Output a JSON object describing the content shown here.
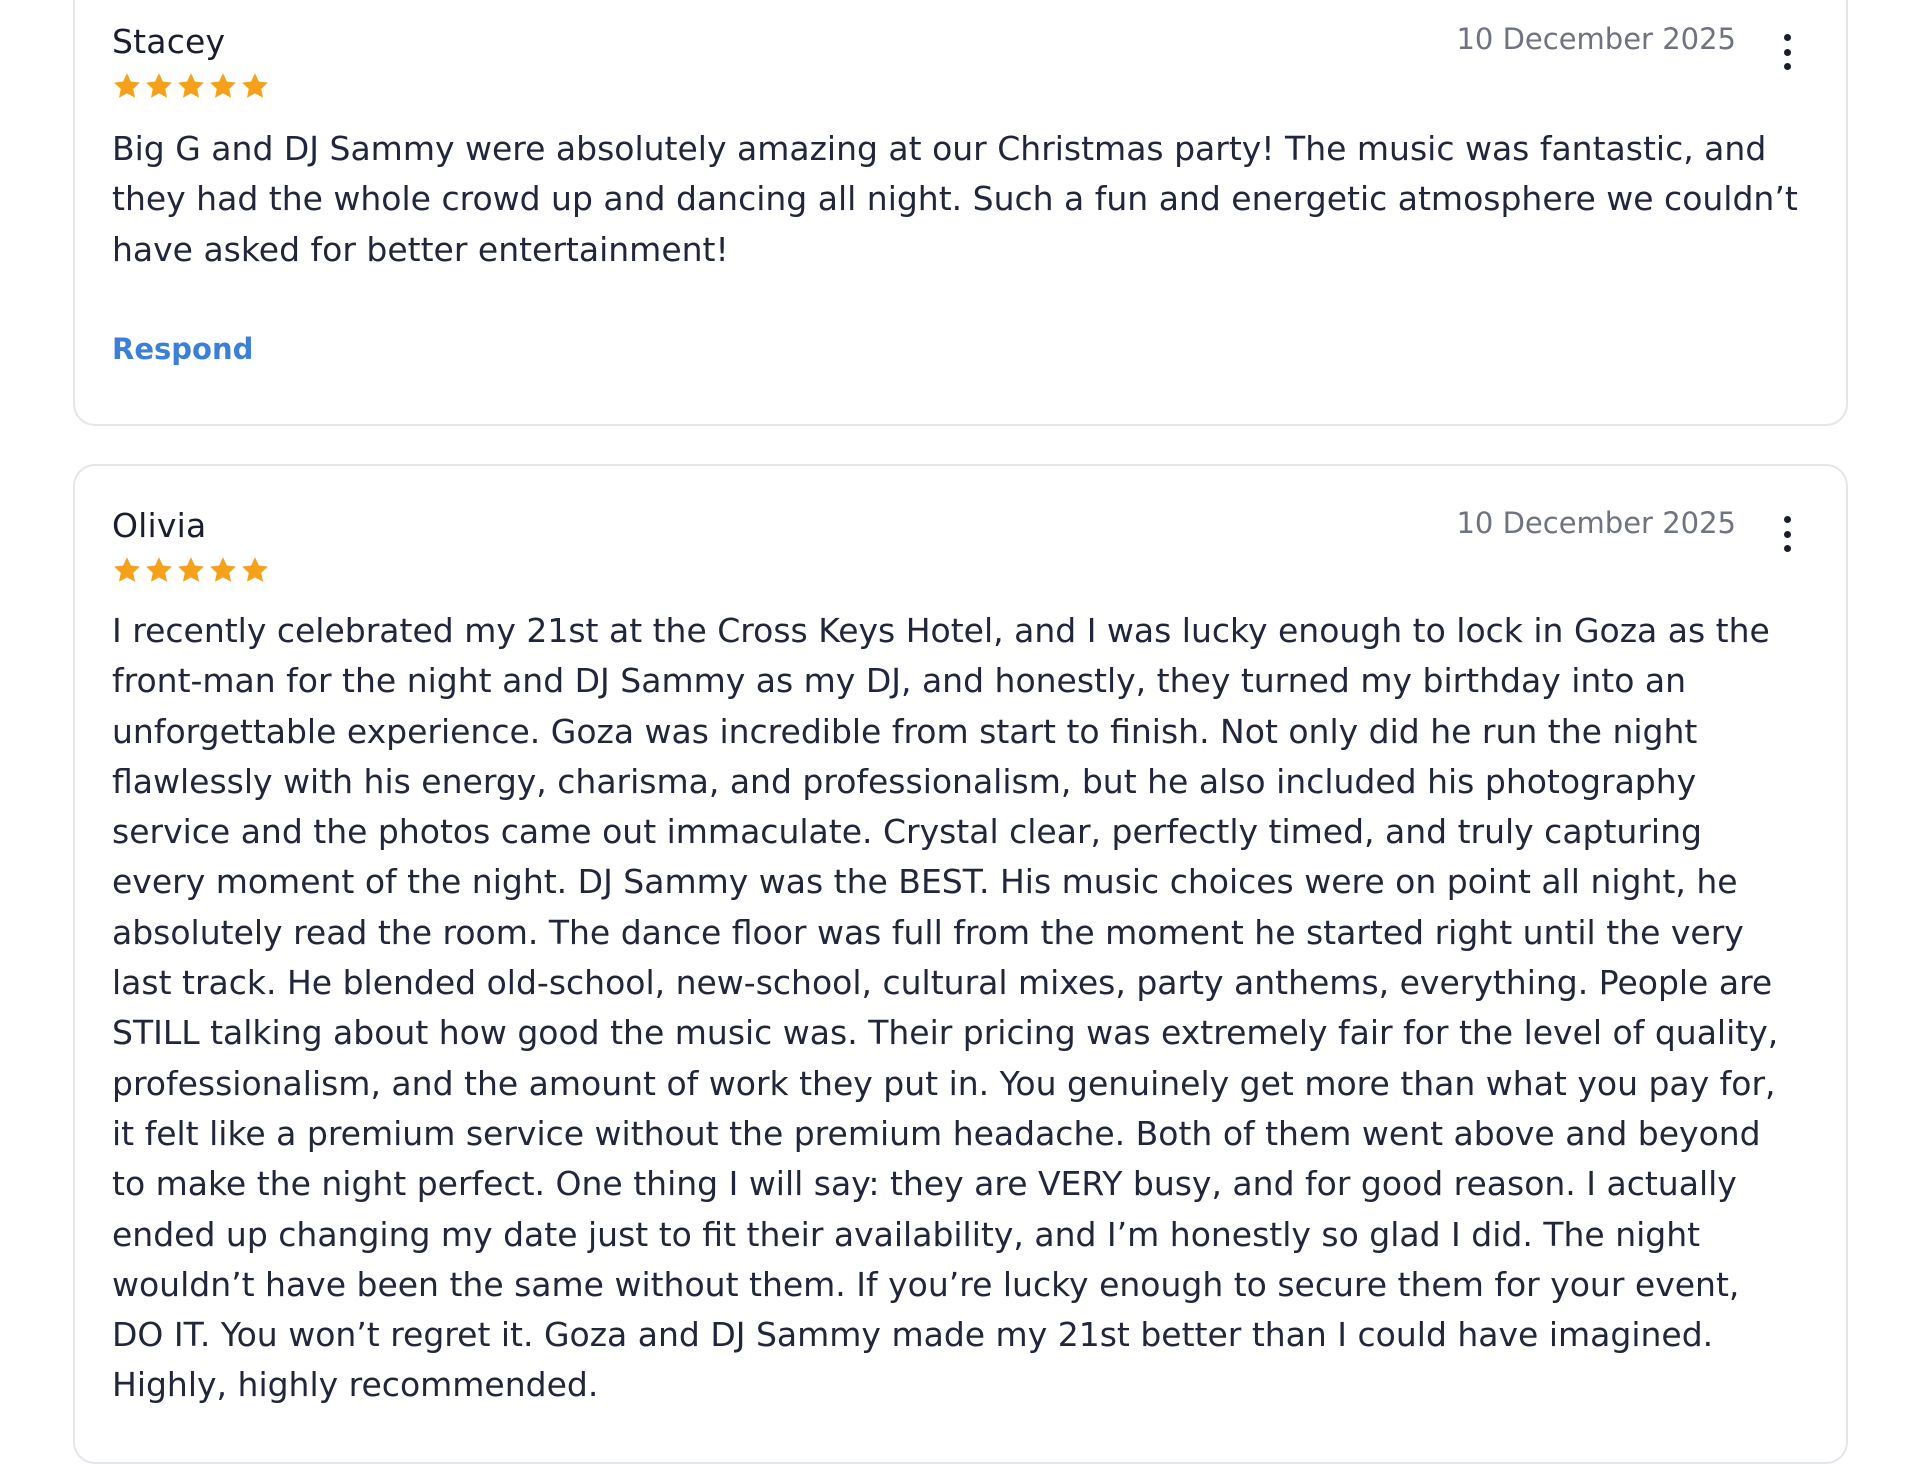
{
  "reviews": [
    {
      "author": "Stacey",
      "rating": 5,
      "date": "10 December 2025",
      "text": "Big G and DJ Sammy were absolutely amazing at our Christmas party! The music was fantastic, and they had the whole crowd up and dancing all night. Such a fun and energetic atmosphere we couldn’t have asked for better entertainment!",
      "respond_label": "Respond"
    },
    {
      "author": "Olivia",
      "rating": 5,
      "date": "10 December 2025",
      "text": "I recently celebrated my 21st at the Cross Keys Hotel, and I was lucky enough to lock in Goza as the front-man for the night and DJ Sammy as my DJ, and honestly, they turned my birthday into an unforgettable experience. Goza was incredible from start to finish. Not only did he run the night flawlessly with his energy, charisma, and professionalism, but he also included his photography service and the photos came out immaculate. Crystal clear, perfectly timed, and truly capturing every moment of the night. DJ Sammy was the BEST. His music choices were on point all night, he absolutely read the room. The dance floor was full from the moment he started right until the very last track. He blended old-school, new-school, cultural mixes, party anthems, everything. People are STILL talking about how good the music was. Their pricing was extremely fair for the level of quality, professionalism, and the amount of work they put in. You genuinely get more than what you pay for, it felt like a premium service without the premium headache. Both of them went above and beyond to make the night perfect. One thing I will say: they are VERY busy, and for good reason. I actually ended up changing my date just to fit their availability, and I’m honestly so glad I did. The night wouldn’t have been the same without them. If you’re lucky enough to secure them for your event, DO IT. You won’t regret it. Goza and DJ Sammy made my 21st better than I could have imagined. Highly, highly recommended."
    }
  ],
  "colors": {
    "star": "#f5a11c",
    "link": "#3b7fd6",
    "date": "#6f7380",
    "border": "#e4e6ea"
  },
  "icons": {
    "rating": "star-icon",
    "menu": "more-vertical-icon"
  }
}
